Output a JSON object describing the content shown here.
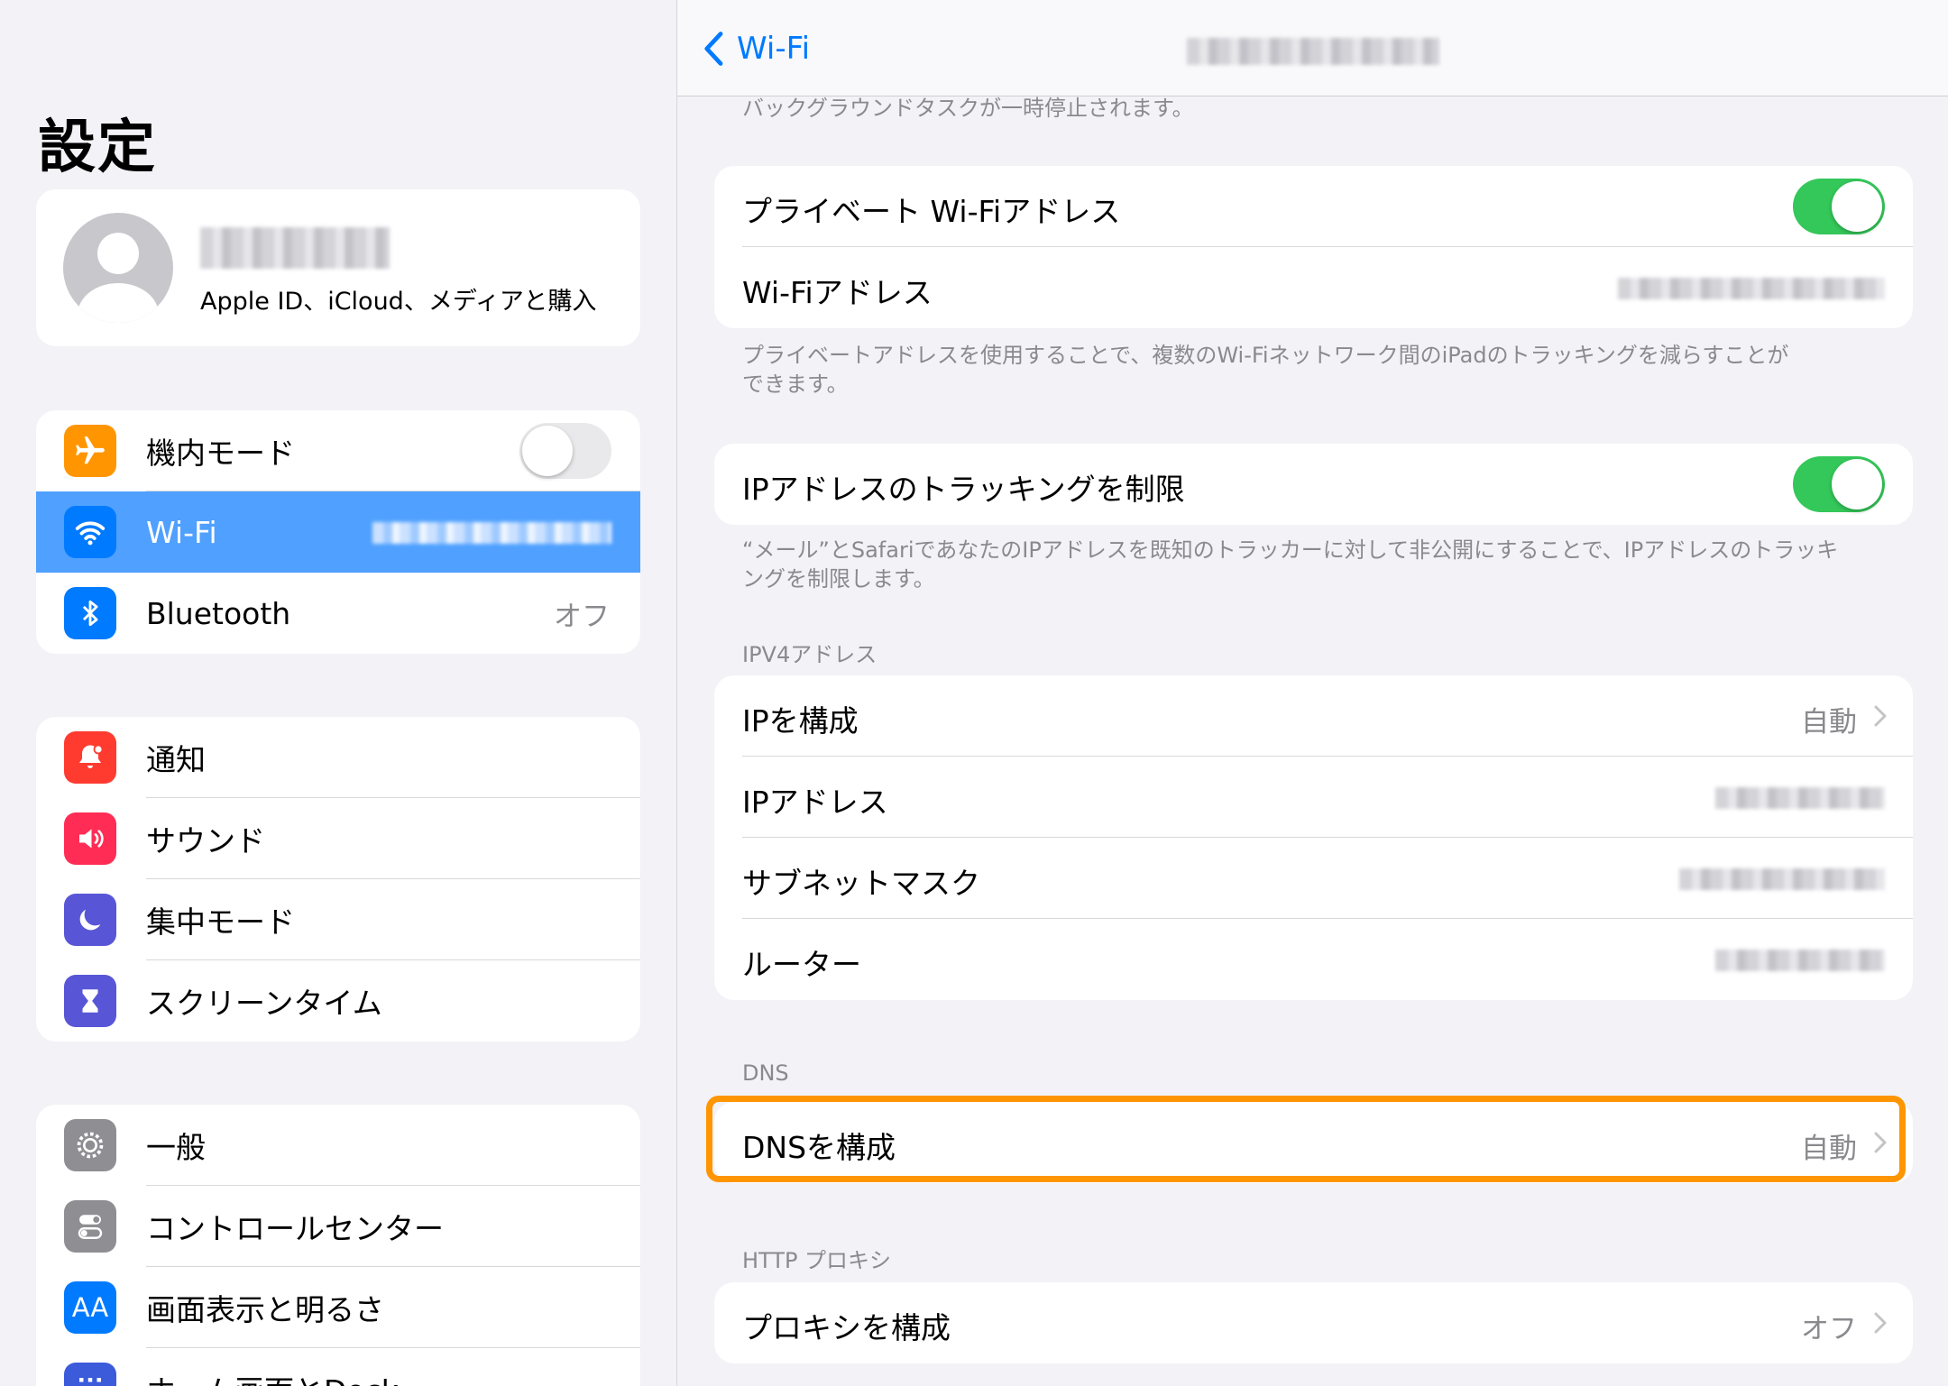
{
  "sidebar": {
    "title": "設定",
    "profile": {
      "subtitle": "Apple ID、iCloud、メディアと購入"
    },
    "group1": [
      {
        "label": "機内モード",
        "icon": "airplane-icon",
        "color": "#ff9500"
      },
      {
        "label": "Wi-Fi",
        "icon": "wifi-icon",
        "color": "#007aff"
      },
      {
        "label": "Bluetooth",
        "value": "オフ",
        "icon": "bluetooth-icon",
        "color": "#007aff"
      }
    ],
    "group2": [
      {
        "label": "通知",
        "icon": "bell-icon",
        "color": "#ff3b30"
      },
      {
        "label": "サウンド",
        "icon": "speaker-icon",
        "color": "#ff2d55"
      },
      {
        "label": "集中モード",
        "icon": "moon-icon",
        "color": "#5856d6"
      },
      {
        "label": "スクリーンタイム",
        "icon": "hourglass-icon",
        "color": "#5856d6"
      }
    ],
    "group3": [
      {
        "label": "一般",
        "icon": "gear-icon",
        "color": "#8e8e93"
      },
      {
        "label": "コントロールセンター",
        "icon": "switches-icon",
        "color": "#8e8e93"
      },
      {
        "label": "画面表示と明るさ",
        "icon": "text-size-icon",
        "color": "#007aff"
      },
      {
        "label": "ホーム画面とDock",
        "icon": "grid-icon",
        "color": "#3b5bdb"
      }
    ]
  },
  "nav": {
    "back_label": "Wi-Fi"
  },
  "main": {
    "top_footnote": "バックグラウンドタスクが一時停止されます。",
    "private_card": {
      "private_label": "プライベート Wi-Fiアドレス",
      "address_label": "Wi-Fiアドレス"
    },
    "private_footnote_1": "プライベートアドレスを使用することで、複数のWi-Fiネットワーク間のiPadのトラッキングを減らすことが",
    "private_footnote_2": "できます。",
    "tracking_label": "IPアドレスのトラッキングを制限",
    "tracking_footnote_1": "“メール”とSafariであなたのIPアドレスを既知のトラッカーに対して非公開にすることで、IPアドレスのトラッキ",
    "tracking_footnote_2": "ングを制限します。",
    "ipv4_header": "IPV4アドレス",
    "ipv4": {
      "configure_label": "IPを構成",
      "configure_value": "自動",
      "address_label": "IPアドレス",
      "subnet_label": "サブネットマスク",
      "router_label": "ルーター"
    },
    "dns_header": "DNS",
    "dns": {
      "label": "DNSを構成",
      "value": "自動"
    },
    "http_header": "HTTP プロキシ",
    "proxy": {
      "label": "プロキシを構成",
      "value": "オフ"
    }
  },
  "colors": {
    "accent": "#007aff",
    "toggle_on": "#34c759",
    "highlight": "#ff9500"
  }
}
